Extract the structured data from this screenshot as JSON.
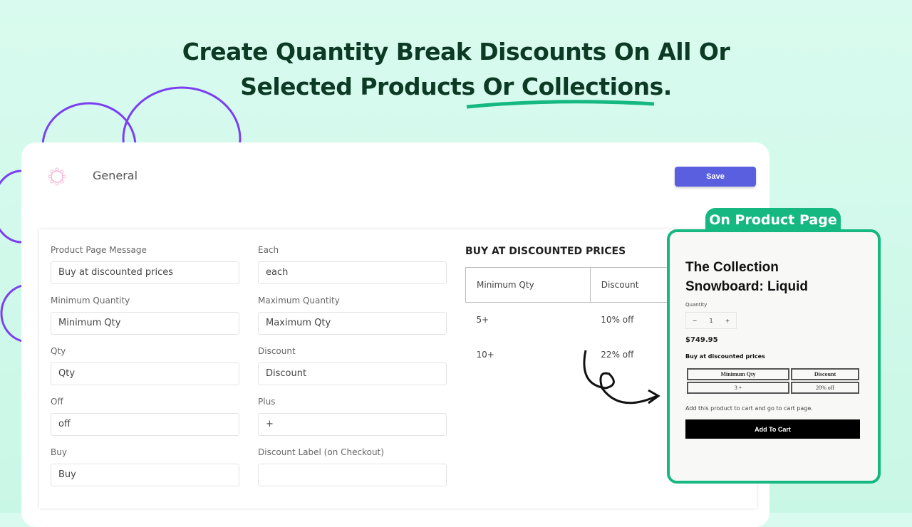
{
  "headline": {
    "line1": "Create Quantity Break Discounts On All Or",
    "line2": "Selected Products Or Collections."
  },
  "header": {
    "title": "General",
    "save_label": "Save"
  },
  "form": {
    "fields": [
      {
        "label": "Product Page Message",
        "value": "Buy at discounted prices"
      },
      {
        "label": "Each",
        "value": "each"
      },
      {
        "label": "Minimum Quantity",
        "value": "Minimum Qty"
      },
      {
        "label": "Maximum Quantity",
        "value": "Maximum Qty"
      },
      {
        "label": "Qty",
        "value": "Qty"
      },
      {
        "label": "Discount",
        "value": "Discount"
      },
      {
        "label": "Off",
        "value": "off"
      },
      {
        "label": "Plus",
        "value": "+"
      },
      {
        "label": "Buy",
        "value": "Buy"
      },
      {
        "label": "Discount Label (on Checkout)",
        "value": ""
      }
    ]
  },
  "preview": {
    "title": "BUY AT DISCOUNTED PRICES",
    "headers": [
      "Minimum Qty",
      "Discount"
    ],
    "rows": [
      [
        "5+",
        "10% off"
      ],
      [
        "10+",
        "22% off"
      ]
    ]
  },
  "product": {
    "tab": "On Product Page",
    "title_line1": "The Collection",
    "title_line2": "Snowboard: Liquid",
    "quantity_label": "Quantity",
    "qty_minus": "−",
    "qty": "1",
    "qty_plus": "+",
    "price": "$749.95",
    "message": "Buy at discounted prices",
    "headers": [
      "Minimum Qty",
      "Discount"
    ],
    "row": [
      "3 +",
      "20% off"
    ],
    "note": "Add this product to cart and go to cart page.",
    "cart_label": "Add To Cart"
  },
  "colors": {
    "accent": "#5a5fe0",
    "green": "#15b881",
    "headline": "#0d3a25",
    "purple": "#7b3ff2"
  }
}
